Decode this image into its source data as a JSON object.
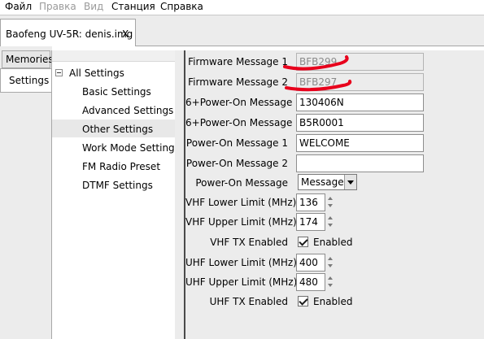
{
  "menubar": {
    "items": [
      {
        "label": "Файл",
        "enabled": true
      },
      {
        "label": "Правка",
        "enabled": false
      },
      {
        "label": "Вид",
        "enabled": false
      },
      {
        "label": "Станция",
        "enabled": true
      },
      {
        "label": "Справка",
        "enabled": true
      }
    ]
  },
  "document_tab": {
    "title": "Baofeng UV-5R: denis.img",
    "close_glyph": "X"
  },
  "side_tabs": {
    "memories": "Memories",
    "settings": "Settings"
  },
  "tree": {
    "root": "All Settings",
    "items": [
      "Basic Settings",
      "Advanced Settings",
      "Other Settings",
      "Work Mode Settings",
      "FM Radio Preset",
      "DTMF Settings"
    ],
    "selected": "Other Settings"
  },
  "form": {
    "firmware_message_1": {
      "label": "Firmware Message 1",
      "value": "BFB299"
    },
    "firmware_message_2": {
      "label": "Firmware Message 2",
      "value": "BFB297"
    },
    "six_power_on_message_1": {
      "label": "6+Power-On Message 1",
      "value": "130406N"
    },
    "six_power_on_message_2": {
      "label": "6+Power-On Message 2",
      "value": "B5R0001"
    },
    "power_on_message_1": {
      "label": "Power-On Message 1",
      "value": "WELCOME"
    },
    "power_on_message_2": {
      "label": "Power-On Message 2",
      "value": ""
    },
    "power_on_message": {
      "label": "Power-On Message",
      "value": "Message"
    },
    "vhf_lower_limit": {
      "label": "VHF Lower Limit (MHz)",
      "value": "136"
    },
    "vhf_upper_limit": {
      "label": "VHF Upper Limit (MHz)",
      "value": "174"
    },
    "vhf_tx_enabled": {
      "label": "VHF TX Enabled",
      "checkbox_label": "Enabled",
      "checked": true
    },
    "uhf_lower_limit": {
      "label": "UHF Lower Limit (MHz)",
      "value": "400"
    },
    "uhf_upper_limit": {
      "label": "UHF Upper Limit (MHz)",
      "value": "480"
    },
    "uhf_tx_enabled": {
      "label": "UHF TX Enabled",
      "checkbox_label": "Enabled",
      "checked": true
    }
  },
  "annotation_color": "#e8001c",
  "icons": {
    "tree_expander": "minus-box-icon",
    "combo_arrow": "chevron-down-icon",
    "spin": "spin-arrows-icon",
    "checkbox": "checkmark-icon"
  }
}
